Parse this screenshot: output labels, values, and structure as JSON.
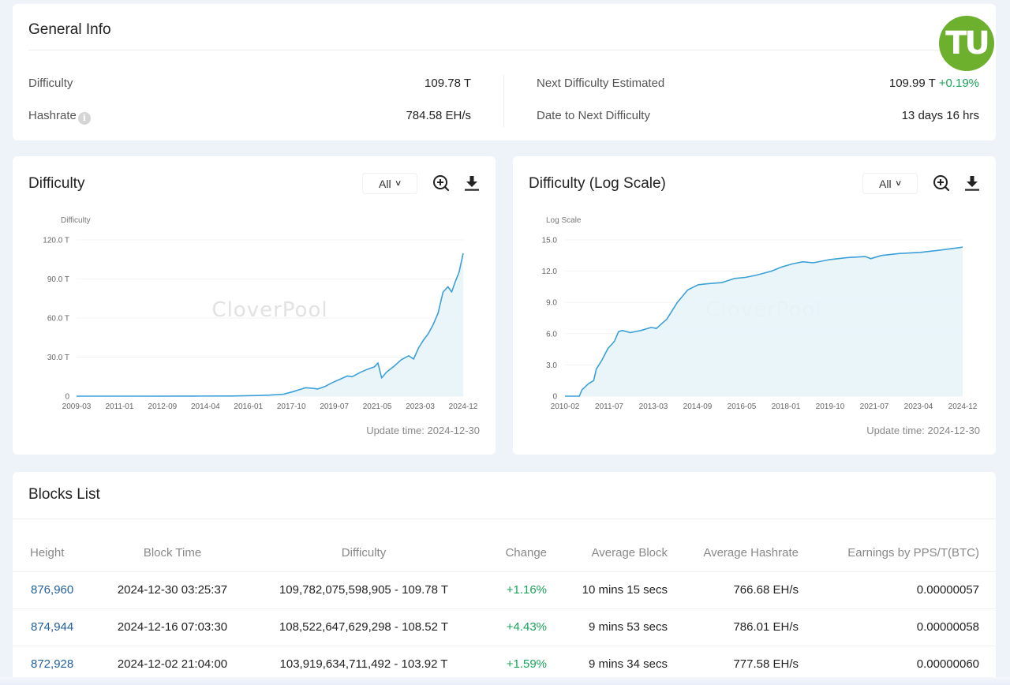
{
  "general": {
    "title": "General Info",
    "difficulty_label": "Difficulty",
    "difficulty_value": "109.78 T",
    "hashrate_label": "Hashrate",
    "hashrate_info_icon": "info-icon",
    "hashrate_value": "784.58 EH/s",
    "next_label": "Next Difficulty Estimated",
    "next_value": "109.99 T",
    "next_change": "+0.19%",
    "date_label": "Date to Next Difficulty",
    "date_value": "13 days 16 hrs"
  },
  "logo": {
    "text": "TU",
    "color": "#6db02e"
  },
  "charts": [
    {
      "title": "Difficulty",
      "range_select": "All",
      "zoom_icon": "zoom-in-icon",
      "download_icon": "download-icon",
      "update_time": "Update time: 2024-12-30"
    },
    {
      "title": "Difficulty (Log Scale)",
      "range_select": "All",
      "zoom_icon": "zoom-in-icon",
      "download_icon": "download-icon",
      "update_time": "Update time: 2024-12-30"
    }
  ],
  "chart_data": [
    {
      "type": "area",
      "title": "Difficulty",
      "ylabel": "Difficulty",
      "xlabel": "",
      "watermark": "CloverPool",
      "ylim": [
        0,
        120
      ],
      "y_unit": "T",
      "yticks": [
        "0",
        "30.0 T",
        "60.0 T",
        "90.0 T",
        "120.0 T"
      ],
      "ytick_values": [
        0,
        30,
        60,
        90,
        120
      ],
      "xticks": [
        "2009-03",
        "2011-01",
        "2012-09",
        "2014-04",
        "2016-01",
        "2017-10",
        "2019-07",
        "2021-05",
        "2023-03",
        "2024-12"
      ],
      "xlim": [
        2009.17,
        2024.92
      ],
      "grid": true,
      "color": "#3ba0d8",
      "x": [
        2009.17,
        2012.0,
        2014.0,
        2015.5,
        2016.5,
        2017.0,
        2017.6,
        2018.0,
        2018.5,
        2018.8,
        2019.0,
        2019.3,
        2019.6,
        2019.9,
        2020.2,
        2020.4,
        2020.7,
        2021.0,
        2021.3,
        2021.45,
        2021.6,
        2021.8,
        2022.1,
        2022.4,
        2022.7,
        2022.9,
        2023.1,
        2023.3,
        2023.5,
        2023.7,
        2023.9,
        2024.1,
        2024.3,
        2024.45,
        2024.6,
        2024.75,
        2024.92
      ],
      "values": [
        0,
        0.002,
        0.05,
        0.1,
        0.5,
        0.8,
        1.5,
        3.5,
        6.5,
        6.0,
        5.5,
        7.5,
        10.5,
        13,
        15.5,
        15.0,
        18.0,
        20.5,
        22.5,
        25.5,
        14.0,
        18.5,
        23.0,
        28.0,
        31.0,
        28.5,
        37.0,
        43.0,
        48.0,
        55.0,
        64.0,
        80.0,
        84.0,
        80.0,
        88.0,
        95.0,
        109.78
      ]
    },
    {
      "type": "area",
      "title": "Difficulty (Log Scale)",
      "ylabel": "Log Scale",
      "xlabel": "",
      "watermark": "CloverPool",
      "ylim": [
        0,
        15
      ],
      "yticks": [
        "0",
        "3.0",
        "6.0",
        "9.0",
        "12.0",
        "15.0"
      ],
      "ytick_values": [
        0,
        3,
        6,
        9,
        12,
        15
      ],
      "xticks": [
        "2010-02",
        "2011-07",
        "2013-03",
        "2014-09",
        "2016-05",
        "2018-01",
        "2019-10",
        "2021-07",
        "2023-04",
        "2024-12"
      ],
      "xlim": [
        2009.7,
        2024.92
      ],
      "grid": true,
      "color": "#3ba0d8",
      "x": [
        2009.7,
        2010.25,
        2010.35,
        2010.6,
        2010.8,
        2010.9,
        2011.1,
        2011.35,
        2011.5,
        2011.6,
        2011.75,
        2011.9,
        2012.2,
        2012.6,
        2013.0,
        2013.2,
        2013.6,
        2014.0,
        2014.4,
        2014.8,
        2015.2,
        2015.7,
        2016.2,
        2016.6,
        2017.0,
        2017.6,
        2018.0,
        2018.4,
        2018.8,
        2019.2,
        2019.8,
        2020.5,
        2021.2,
        2021.4,
        2021.8,
        2022.5,
        2023.3,
        2024.0,
        2024.92
      ],
      "values": [
        0,
        0,
        0.6,
        1.2,
        1.5,
        2.6,
        3.4,
        4.6,
        5.0,
        5.3,
        6.2,
        6.3,
        6.1,
        6.3,
        6.6,
        6.5,
        7.4,
        9.0,
        10.2,
        10.7,
        10.8,
        10.9,
        11.3,
        11.4,
        11.6,
        12.0,
        12.4,
        12.7,
        12.9,
        12.8,
        13.1,
        13.3,
        13.4,
        13.2,
        13.5,
        13.7,
        13.8,
        14.0,
        14.3
      ]
    }
  ],
  "blocks": {
    "title": "Blocks List",
    "columns": [
      "Height",
      "Block Time",
      "Difficulty",
      "Change",
      "Average Block",
      "Average Hashrate",
      "Earnings by PPS/T(BTC)"
    ],
    "rows": [
      [
        "876,960",
        "2024-12-30 03:25:37",
        "109,782,075,598,905 - 109.78 T",
        "+1.16%",
        "10 mins 15 secs",
        "766.68 EH/s",
        "0.00000057"
      ],
      [
        "874,944",
        "2024-12-16 07:03:30",
        "108,522,647,629,298 - 108.52 T",
        "+4.43%",
        "9 mins 53 secs",
        "786.01 EH/s",
        "0.00000058"
      ],
      [
        "872,928",
        "2024-12-02 21:04:00",
        "103,919,634,711,492 - 103.92 T",
        "+1.59%",
        "9 mins 34 secs",
        "777.58 EH/s",
        "0.00000060"
      ]
    ]
  },
  "colors": {
    "link": "#1f5f9e",
    "positive": "#1aa45a",
    "line": "#3ba0d8",
    "area": "#e8f4fa"
  }
}
